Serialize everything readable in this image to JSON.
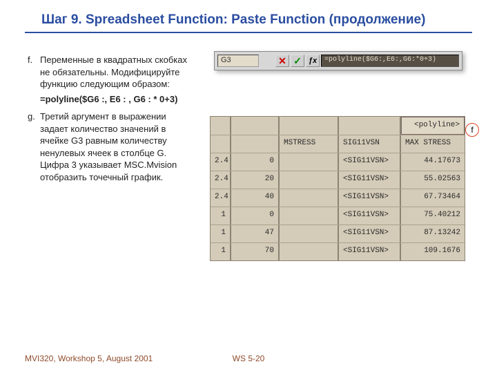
{
  "title": "Шаг 9.  Spreadsheet Function:  Paste Function (продолжение)",
  "left": {
    "f_letter": "f.",
    "f_text": "Переменные в квадратных скобках не обязательны. Модифицируйте функцию следующим образом:",
    "f_formula": "=polyline($G6 :, E6 : , G6 : * 0+3)",
    "g_letter": "g.",
    "g_text": "Третий аргумент в выражении задает количество значений в ячейке G3 равным количеству ненулевых ячеек в столбце G. Цифра 3 указывает MSC.Mvision отобразить точечный график."
  },
  "formula_bar": {
    "cell_ref": "G3",
    "cancel": "✕",
    "accept": "✓",
    "fx": "ƒx",
    "input": "=polyline($G6:,E6:,G6:*0+3)"
  },
  "callout_f": "f",
  "sheet": {
    "poly_label": "<polyline>",
    "headers": {
      "c3": "MSTRESS",
      "c4": "SIG11VSN",
      "c5": "MAX STRESS"
    },
    "rows": [
      {
        "c1": "2.4",
        "c2": "0",
        "c3": "<SIG11VSN>",
        "c5": "44.17673"
      },
      {
        "c1": "2.4",
        "c2": "20",
        "c3": "<SIG11VSN>",
        "c5": "55.02563"
      },
      {
        "c1": "2.4",
        "c2": "40",
        "c3": "<SIG11VSN>",
        "c5": "67.73464"
      },
      {
        "c1": "1",
        "c2": "0",
        "c3": "<SIG11VSN>",
        "c5": "75.40212"
      },
      {
        "c1": "1",
        "c2": "47",
        "c3": "<SIG11VSN>",
        "c5": "87.13242"
      },
      {
        "c1": "1",
        "c2": "70",
        "c3": "<SIG11VSN>",
        "c5": "109.1676"
      }
    ]
  },
  "footer": {
    "left": "MVI320, Workshop 5, August 2001",
    "center": "WS 5-20"
  }
}
